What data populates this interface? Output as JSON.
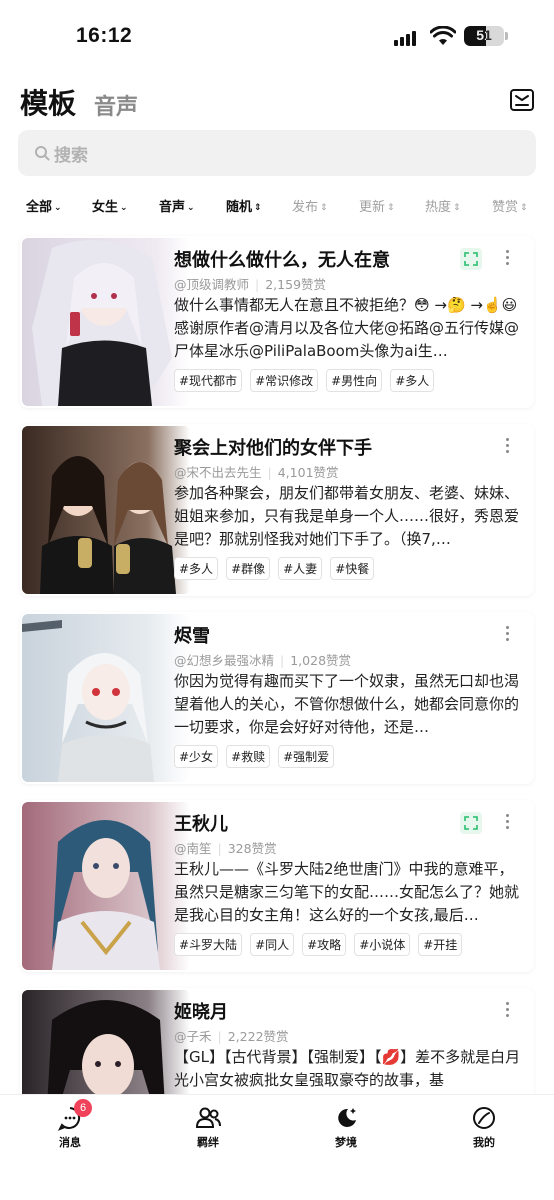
{
  "status_bar": {
    "time": "16:12",
    "battery": "51"
  },
  "header": {
    "tab_active": "模板",
    "tab_inactive": "音声"
  },
  "search": {
    "placeholder": "搜索"
  },
  "filters": [
    {
      "label": "全部",
      "active": true
    },
    {
      "label": "女生",
      "active": true
    },
    {
      "label": "音声",
      "active": true
    },
    {
      "label": "随机",
      "active": true
    },
    {
      "label": "发布",
      "active": false
    },
    {
      "label": "更新",
      "active": false
    },
    {
      "label": "热度",
      "active": false
    },
    {
      "label": "赞赏",
      "active": false
    }
  ],
  "cards": [
    {
      "title": "想做什么做什么，无人在意",
      "author": "@顶级调教师",
      "likes": "2,159赞赏",
      "description": "做什么事情都无人在意且不被拒绝？😳 →🤔 →☝️😃 感谢原作者@清月以及各位大佬@拓路@五行传媒@尸体星冰乐@PiliPalaBoom头像为ai生…",
      "tags": [
        "#现代都市",
        "#常识修改",
        "#男性向",
        "#多人"
      ],
      "expand_icon": true
    },
    {
      "title": "聚会上对他们的女伴下手",
      "author": "@宋不出去先生",
      "likes": "4,101赞赏",
      "description": "参加各种聚会，朋友们都带着女朋友、老婆、妹妹、姐姐来参加，只有我是单身一个人……很好，秀恩爱是吧？那就别怪我对她们下手了。（换7,…",
      "tags": [
        "#多人",
        "#群像",
        "#人妻",
        "#快餐"
      ],
      "expand_icon": false
    },
    {
      "title": "烬雪",
      "author": "@幻想乡最强冰精",
      "likes": "1,028赞赏",
      "description": "你因为觉得有趣而买下了一个奴隶，虽然无口却也渴望着他人的关心，不管你想做什么，她都会同意你的一切要求，你是会好好对待他，还是…",
      "tags": [
        "#少女",
        "#救赎",
        "#强制爱"
      ],
      "expand_icon": false
    },
    {
      "title": "王秋儿",
      "author": "@南笙",
      "likes": "328赞赏",
      "description": "王秋儿——《斗罗大陆2绝世唐门》中我的意难平，虽然只是糖家三匀笔下的女配……女配怎么了？她就是我心目的女主角！这么好的一个女孩,最后…",
      "tags": [
        "#斗罗大陆",
        "#同人",
        "#攻略",
        "#小说体",
        "#开挂"
      ],
      "expand_icon": true
    },
    {
      "title": "姬晓月",
      "author": "@子禾",
      "likes": "2,222赞赏",
      "description": "【GL】【古代背景】【强制爱】【💋】差不多就是白月光小宫女被疯批女皇强取豪夺的故事，基",
      "tags": [],
      "expand_icon": false
    }
  ],
  "bottom_nav": [
    {
      "label": "消息",
      "icon": "message-icon",
      "badge": "6"
    },
    {
      "label": "羁绊",
      "icon": "people-icon",
      "badge": ""
    },
    {
      "label": "梦境",
      "icon": "moon-stars-icon",
      "badge": ""
    },
    {
      "label": "我的",
      "icon": "profile-circle-icon",
      "badge": ""
    }
  ],
  "colors": {
    "accent_green": "#3cc47c",
    "badge_red": "#f0425a"
  }
}
